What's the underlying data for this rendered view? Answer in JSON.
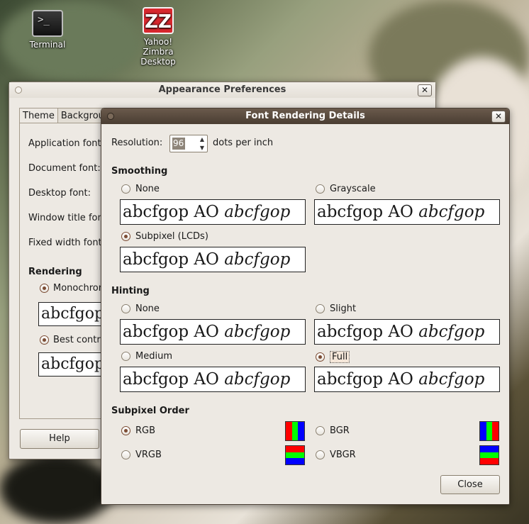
{
  "desktop": {
    "icons": [
      {
        "label": "Terminal",
        "glyph": ">_"
      },
      {
        "label": "Yahoo! Zimbra Desktop",
        "glyph": "ZZ"
      }
    ]
  },
  "appearance": {
    "title": "Appearance Preferences",
    "close": "✕",
    "tabs": [
      "Theme",
      "Backgrou"
    ],
    "fonts": [
      "Application font",
      "Document font:",
      "Desktop font:",
      "Window title font",
      "Fixed width font:"
    ],
    "rendering_title": "Rendering",
    "rendering_options": [
      "Monochrom",
      "Best contr"
    ],
    "sample": "abcfgop",
    "help": "Help"
  },
  "details": {
    "title": "Font Rendering Details",
    "close": "✕",
    "resolution_label": "Resolution:",
    "resolution_value": "96",
    "resolution_unit": "dots per inch",
    "smoothing": {
      "title": "Smoothing",
      "options": [
        {
          "label": "None",
          "selected": false
        },
        {
          "label": "Grayscale",
          "selected": false
        },
        {
          "label": "Subpixel (LCDs)",
          "selected": true
        }
      ]
    },
    "hinting": {
      "title": "Hinting",
      "options": [
        {
          "label": "None",
          "selected": false
        },
        {
          "label": "Slight",
          "selected": false
        },
        {
          "label": "Medium",
          "selected": false
        },
        {
          "label": "Full",
          "selected": true
        }
      ]
    },
    "subpixel_order": {
      "title": "Subpixel Order",
      "options": [
        {
          "label": "RGB",
          "selected": true,
          "colors": [
            "#ff0000",
            "#00ff00",
            "#0000ff"
          ]
        },
        {
          "label": "BGR",
          "selected": false,
          "colors": [
            "#0000ff",
            "#00ff00",
            "#ff0000"
          ]
        },
        {
          "label": "VRGB",
          "selected": false,
          "colors": [
            "#ff0000",
            "#00ff00",
            "#0000ff"
          ]
        },
        {
          "label": "VBGR",
          "selected": false,
          "colors": [
            "#0000ff",
            "#00ff00",
            "#ff0000"
          ]
        }
      ]
    },
    "sample_regular": "abcfgop AO",
    "sample_italic": "abcfgop",
    "close_button": "Close"
  }
}
